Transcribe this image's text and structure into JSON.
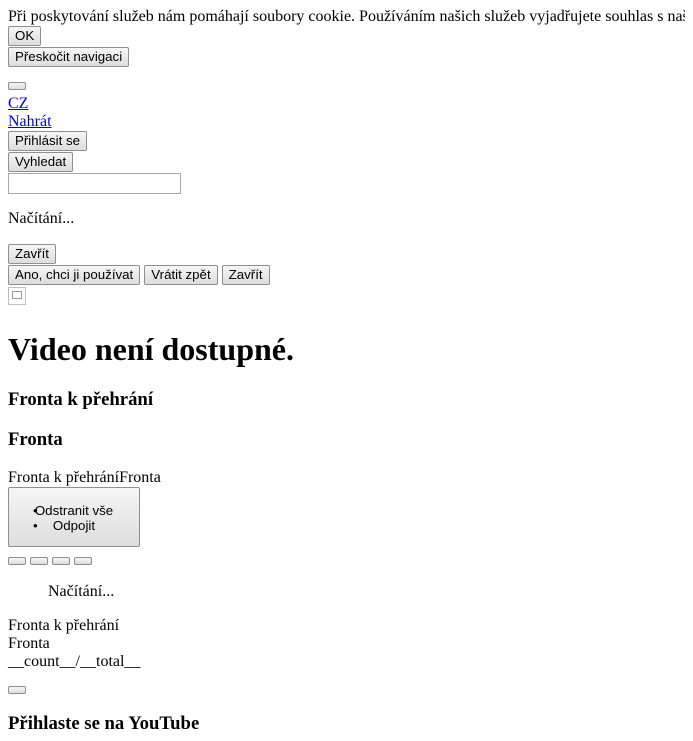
{
  "cookie": {
    "text": "Při poskytování služeb nám pomáhají soubory cookie. Používáním našich služeb vyjadřujete souhlas s naším používáním souborů cookie.",
    "ok_label": "OK"
  },
  "skip_nav_label": "Přeskočit navigaci",
  "header": {
    "country": "CZ",
    "upload": "Nahrát",
    "sign_in": "Přihlásit se",
    "search_button": "Vyhledat",
    "search_value": ""
  },
  "loading1": "Načítání...",
  "close1": "Zavřít",
  "prompt": {
    "accept": "Ano, chci ji používat",
    "undo": "Vrátit zpět",
    "close": "Zavřít"
  },
  "video_unavailable": "Video není dostupné.",
  "queue": {
    "heading_playback": "Fronta k přehrání",
    "heading_queue": "Fronta",
    "inline_text": "Fronta k přehráníFronta",
    "menu": [
      "Odstranit vše",
      "Odpojit"
    ],
    "loading": "Načítání...",
    "line_playback": "Fronta k přehrání",
    "line_queue": "Fronta",
    "counter": "__count__/__total__"
  },
  "signin_heading": "Přihlaste se na YouTube"
}
